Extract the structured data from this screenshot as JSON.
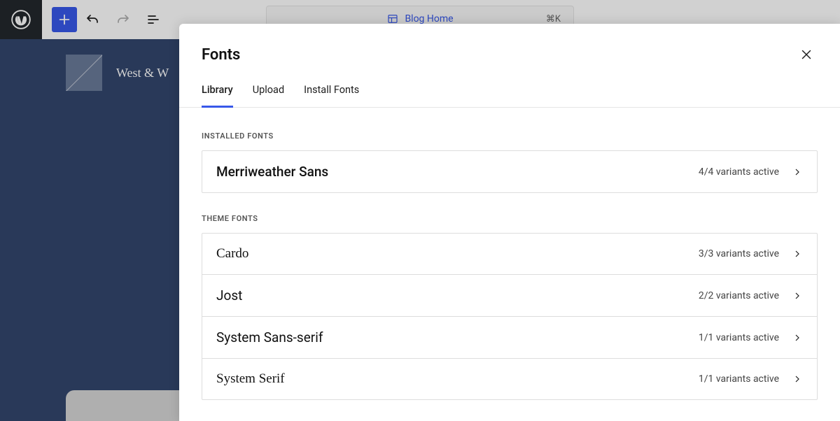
{
  "toolbar": {
    "page_label": "Blog Home",
    "shortcut": "⌘K"
  },
  "canvas": {
    "site_title": "West & W"
  },
  "modal": {
    "title": "Fonts",
    "tabs": [
      {
        "label": "Library",
        "active": true
      },
      {
        "label": "Upload",
        "active": false
      },
      {
        "label": "Install Fonts",
        "active": false
      }
    ],
    "sections": [
      {
        "label": "Installed Fonts",
        "fonts": [
          {
            "name": "Merriweather Sans",
            "variants": "4/4 variants active",
            "serif": false
          }
        ]
      },
      {
        "label": "Theme Fonts",
        "fonts": [
          {
            "name": "Cardo",
            "variants": "3/3 variants active",
            "serif": true
          },
          {
            "name": "Jost",
            "variants": "2/2 variants active",
            "serif": false
          },
          {
            "name": "System Sans-serif",
            "variants": "1/1 variants active",
            "serif": false
          },
          {
            "name": "System Serif",
            "variants": "1/1 variants active",
            "serif": true
          }
        ]
      }
    ]
  }
}
